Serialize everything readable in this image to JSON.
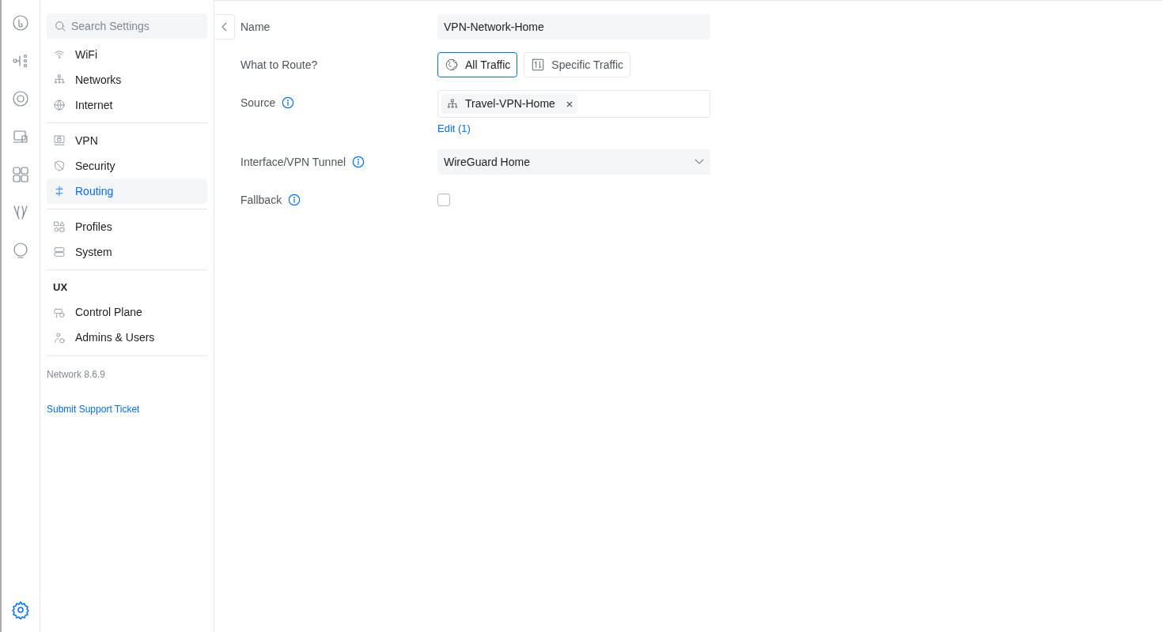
{
  "rail": {
    "items": [
      {
        "selected": false
      },
      {
        "selected": false
      },
      {
        "selected": false
      },
      {
        "selected": false
      },
      {
        "selected": false
      },
      {
        "selected": false
      },
      {
        "selected": false
      }
    ],
    "settings": {
      "selected": true
    }
  },
  "sidebar": {
    "search": {
      "placeholder": "Search Settings"
    },
    "groups": [
      {
        "items": [
          {
            "label": "WiFi",
            "selected": false
          },
          {
            "label": "Networks",
            "selected": false
          },
          {
            "label": "Internet",
            "selected": false
          }
        ]
      },
      {
        "items": [
          {
            "label": "VPN",
            "selected": false
          },
          {
            "label": "Security",
            "selected": false
          },
          {
            "label": "Routing",
            "selected": true
          }
        ]
      },
      {
        "items": [
          {
            "label": "Profiles",
            "selected": false
          },
          {
            "label": "System",
            "selected": false
          }
        ]
      },
      {
        "heading": "UX",
        "items": [
          {
            "label": "Control Plane",
            "selected": false
          },
          {
            "label": "Admins & Users",
            "selected": false
          }
        ]
      }
    ],
    "version": "Network 8.6.9",
    "support_link": "Submit Support Ticket"
  },
  "form": {
    "rows": [
      {
        "kind": "text",
        "label": "Name",
        "info": false,
        "value": "VPN-Network-Home"
      },
      {
        "kind": "segmented",
        "label": "What to Route?",
        "info": false,
        "options": [
          {
            "label": "All Traffic",
            "selected": true
          },
          {
            "label": "Specific Traffic",
            "selected": false
          }
        ]
      },
      {
        "kind": "tags",
        "label": "Source",
        "info": true,
        "tags": [
          "Travel-VPN-Home"
        ],
        "link": "Edit (1)"
      },
      {
        "kind": "select",
        "label": "Interface/VPN Tunnel",
        "info": true,
        "value": "WireGuard Home"
      },
      {
        "kind": "checkbox",
        "label": "Fallback",
        "info": true,
        "checked": false
      }
    ]
  }
}
